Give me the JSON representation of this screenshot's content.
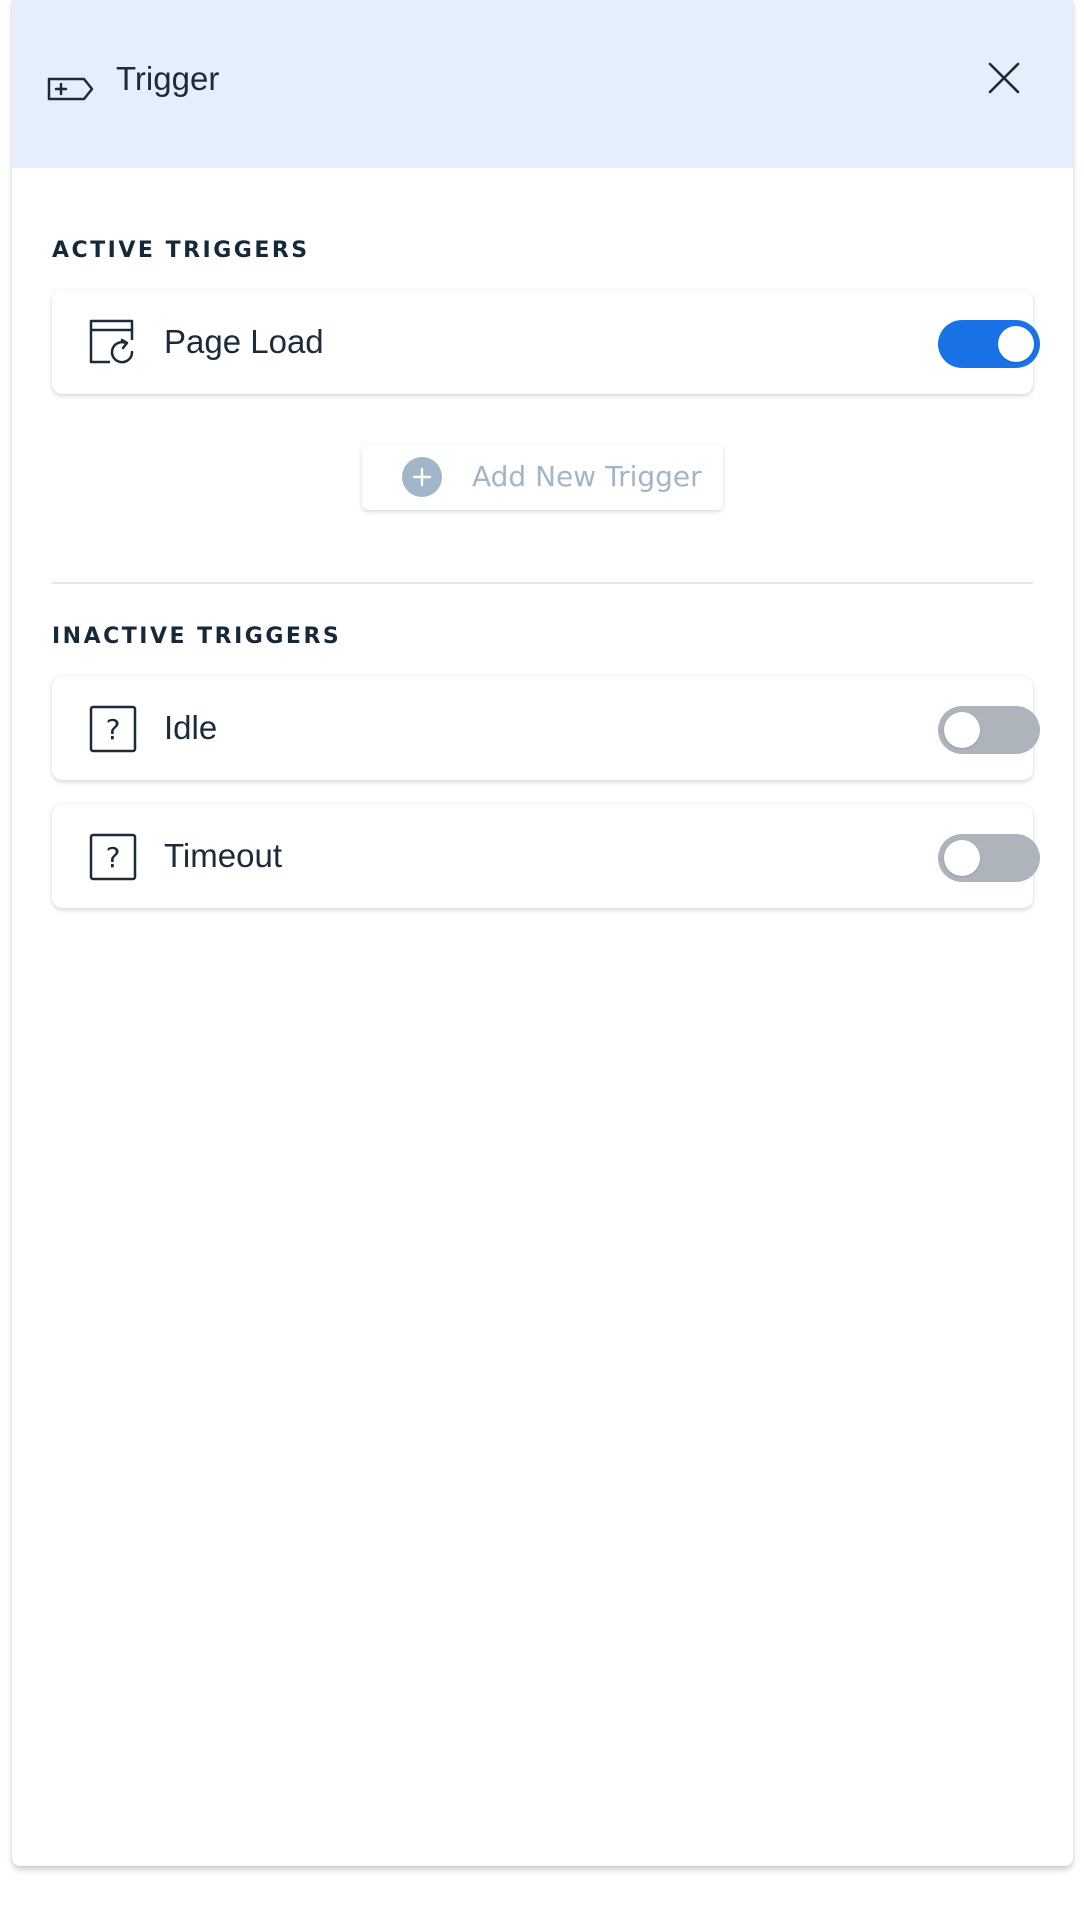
{
  "header": {
    "title": "Trigger",
    "icon": "tag-plus-icon",
    "close_icon": "close-icon"
  },
  "active_section": {
    "label": "ACTIVE TRIGGERS",
    "items": [
      {
        "label": "Page Load",
        "icon": "page-reload-icon",
        "enabled": true
      }
    ]
  },
  "add_button": {
    "label": "Add New Trigger",
    "icon": "plus-circle-icon"
  },
  "inactive_section": {
    "label": "INACTIVE TRIGGERS",
    "items": [
      {
        "label": "Idle",
        "icon": "question-box-icon",
        "enabled": false
      },
      {
        "label": "Timeout",
        "icon": "question-box-icon",
        "enabled": false
      }
    ]
  },
  "colors": {
    "header_bg": "#e5effb",
    "toggle_on": "#1a73e6",
    "toggle_off": "#adb4bb",
    "text_dark": "#1b2b3a",
    "add_text": "#a3b5c8"
  }
}
